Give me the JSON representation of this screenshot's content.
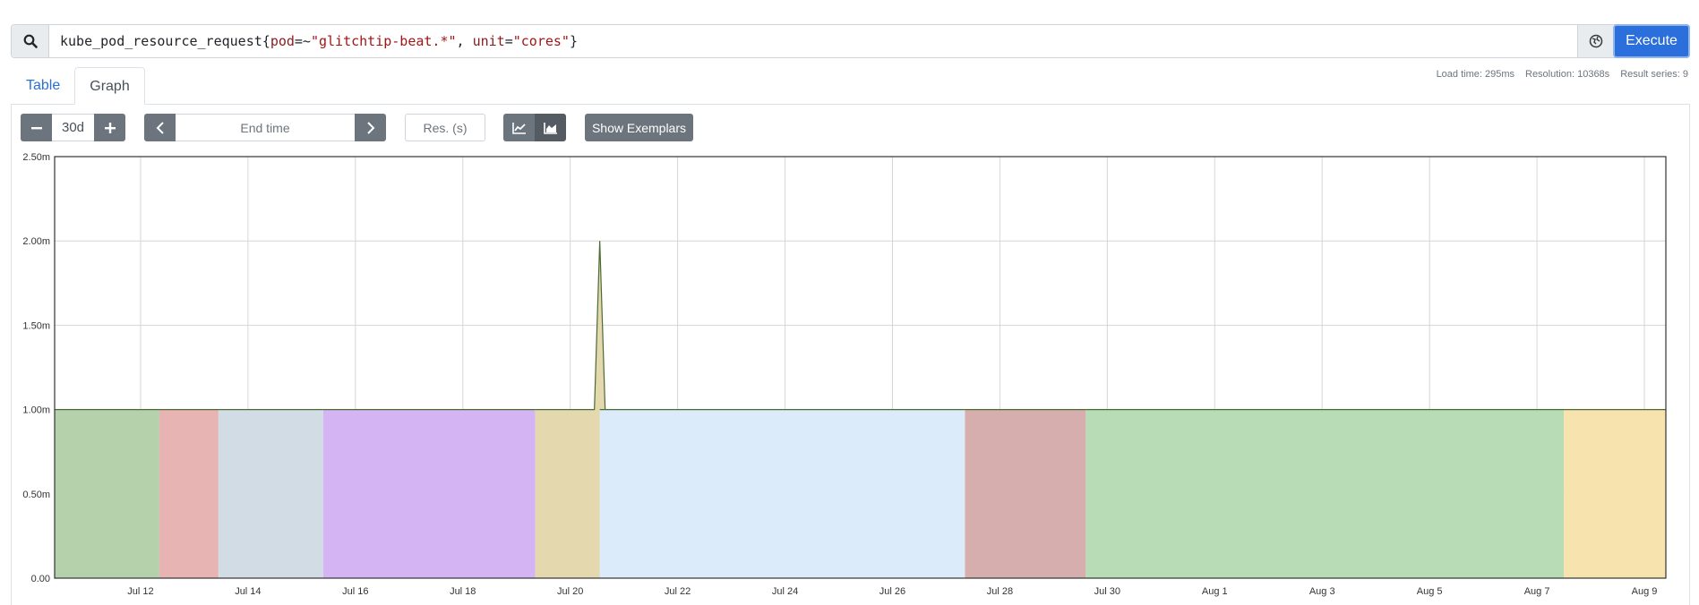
{
  "query": {
    "metric": "kube_pod_resource_request",
    "l1_name": "pod",
    "l1_op": "=~",
    "l1_value": "\"glitchtip-beat.*\"",
    "sep": ", ",
    "l2_name": "unit",
    "l2_op": "=",
    "l2_value": "\"cores\""
  },
  "execute_label": "Execute",
  "tabs": [
    "Table",
    "Graph"
  ],
  "stats": {
    "load_time": "Load time: 295ms",
    "resolution": "Resolution: 10368s",
    "result_series": "Result series: 9"
  },
  "controls": {
    "range": "30d",
    "end_time_placeholder": "End time",
    "res_placeholder": "Res. (s)",
    "exemplars_label": "Show Exemplars"
  },
  "icons": {
    "search": "search-icon",
    "globe": "globe-icon",
    "minus": "minus-icon",
    "plus": "plus-icon",
    "prev": "chevron-left-icon",
    "next": "chevron-right-icon",
    "line": "line-chart-icon",
    "stacked": "stacked-area-chart-icon"
  },
  "chart_data": {
    "type": "area",
    "stacked": true,
    "x_ticks": [
      "Jul 12",
      "Jul 14",
      "Jul 16",
      "Jul 18",
      "Jul 20",
      "Jul 22",
      "Jul 24",
      "Jul 26",
      "Jul 28",
      "Jul 30",
      "Aug 1",
      "Aug 3",
      "Aug 5",
      "Aug 7",
      "Aug 9"
    ],
    "y_ticks": [
      "0.00",
      "0.50m",
      "1.00m",
      "1.50m",
      "2.00m",
      "2.50m"
    ],
    "ylim": [
      0,
      0.0025
    ],
    "x_range_days": [
      -1.6,
      28.4
    ],
    "grid": true,
    "series": [
      {
        "color": "#b4d1ac",
        "x": [
          -1.6,
          0.35
        ],
        "y": [
          0.001,
          0.001
        ]
      },
      {
        "color": "#e7b3b3",
        "x": [
          0.35,
          1.45
        ],
        "y": [
          0.001,
          0.001
        ]
      },
      {
        "color": "#d1dce4",
        "x": [
          1.45,
          3.4
        ],
        "y": [
          0.001,
          0.001
        ]
      },
      {
        "color": "#d4b4f3",
        "x": [
          3.4,
          7.35
        ],
        "y": [
          0.001,
          0.001
        ]
      },
      {
        "color": "#e4d8af",
        "x": [
          7.35,
          8.45,
          8.55,
          8.65
        ],
        "y": [
          0.001,
          0.001,
          0.002,
          0.001
        ]
      },
      {
        "color": "#dcebf9",
        "x": [
          8.55,
          15.35
        ],
        "y": [
          0.001,
          0.001
        ]
      },
      {
        "color": "#d7aeae",
        "x": [
          15.35,
          17.6
        ],
        "y": [
          0.001,
          0.001
        ]
      },
      {
        "color": "#b8dcb6",
        "x": [
          17.6,
          26.5
        ],
        "y": [
          0.001,
          0.001
        ]
      },
      {
        "color": "#f6e3ad",
        "x": [
          26.5,
          28.4
        ],
        "y": [
          0.001,
          0.001
        ]
      }
    ]
  }
}
